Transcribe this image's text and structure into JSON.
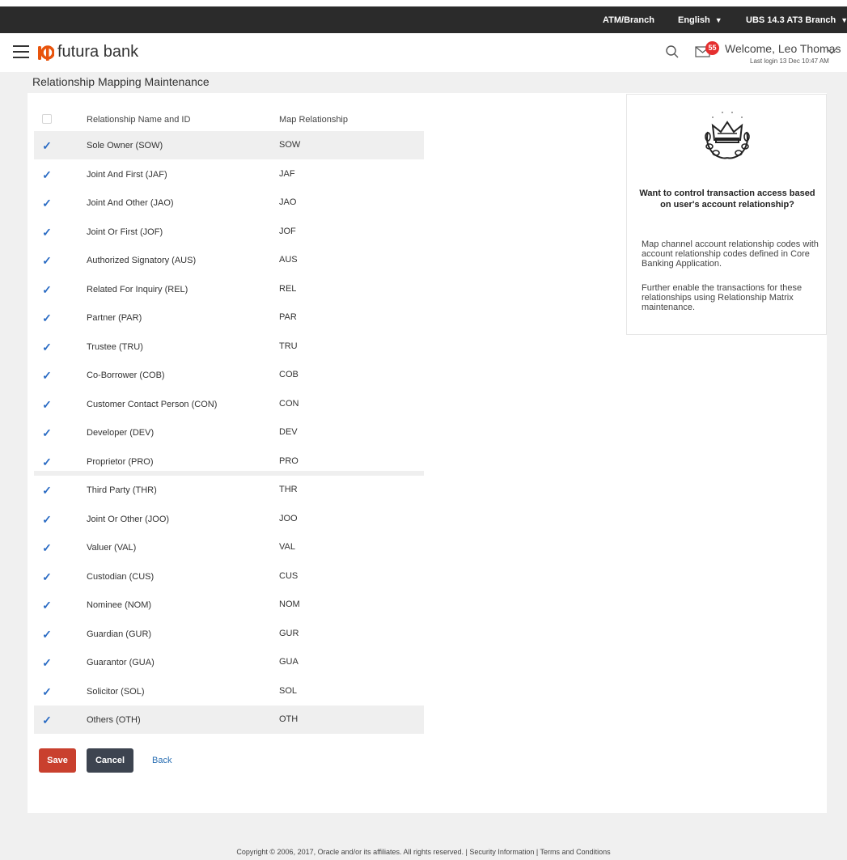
{
  "topbar": {
    "atm_branch": "ATM/Branch",
    "language": "English",
    "branch": "UBS 14.3 AT3 Branch"
  },
  "header": {
    "brand": "futura bank",
    "notification_count": "55",
    "welcome": "Welcome, Leo Thomas",
    "last_login": "Last login 13 Dec 10:47 AM"
  },
  "page": {
    "title": "Relationship Mapping Maintenance"
  },
  "table": {
    "columns": [
      "Relationship Name and ID",
      "Map Relationship"
    ],
    "header_checked": false,
    "rows": [
      {
        "name": "Sole Owner (SOW)",
        "map": "SOW",
        "checked": true
      },
      {
        "name": "Joint And First (JAF)",
        "map": "JAF",
        "checked": true
      },
      {
        "name": "Joint And Other (JAO)",
        "map": "JAO",
        "checked": true
      },
      {
        "name": "Joint Or First (JOF)",
        "map": "JOF",
        "checked": true
      },
      {
        "name": "Authorized Signatory (AUS)",
        "map": "AUS",
        "checked": true
      },
      {
        "name": "Related For Inquiry (REL)",
        "map": "REL",
        "checked": true
      },
      {
        "name": "Partner (PAR)",
        "map": "PAR",
        "checked": true
      },
      {
        "name": "Trustee (TRU)",
        "map": "TRU",
        "checked": true
      },
      {
        "name": "Co-Borrower (COB)",
        "map": "COB",
        "checked": true
      },
      {
        "name": "Customer Contact Person (CON)",
        "map": "CON",
        "checked": true
      },
      {
        "name": "Developer (DEV)",
        "map": "DEV",
        "checked": true
      },
      {
        "name": "Proprietor (PRO)",
        "map": "PRO",
        "checked": true
      },
      {
        "name": "Third Party (THR)",
        "map": "THR",
        "checked": true
      },
      {
        "name": "Joint Or Other (JOO)",
        "map": "JOO",
        "checked": true
      },
      {
        "name": "Valuer (VAL)",
        "map": "VAL",
        "checked": true
      },
      {
        "name": "Custodian (CUS)",
        "map": "CUS",
        "checked": true
      },
      {
        "name": "Nominee (NOM)",
        "map": "NOM",
        "checked": true
      },
      {
        "name": "Guardian (GUR)",
        "map": "GUR",
        "checked": true
      },
      {
        "name": "Guarantor (GUA)",
        "map": "GUA",
        "checked": true
      },
      {
        "name": "Solicitor (SOL)",
        "map": "SOL",
        "checked": true
      },
      {
        "name": "Others (OTH)",
        "map": "OTH",
        "checked": true
      }
    ]
  },
  "actions": {
    "save": "Save",
    "cancel": "Cancel",
    "back": "Back"
  },
  "side_panel": {
    "icon": "crown-laurel-icon",
    "heading": "Want to control transaction access based on user's account relationship?",
    "paragraph1": "Map channel account relationship codes with account relationship codes defined in Core Banking Application.",
    "paragraph2": "Further enable the transactions for these relationships using Relationship Matrix maintenance."
  },
  "footer": {
    "text": "Copyright © 2006, 2017, Oracle and/or its affiliates. All rights reserved. | Security Information | Terms and Conditions"
  },
  "colors": {
    "topbar": "#2b2b2b",
    "save_button": "#c9402e",
    "cancel_button": "#3d4450",
    "checkbox": "#2b6cc4",
    "brand_orange": "#e8540d",
    "badge": "#e52f2f"
  }
}
